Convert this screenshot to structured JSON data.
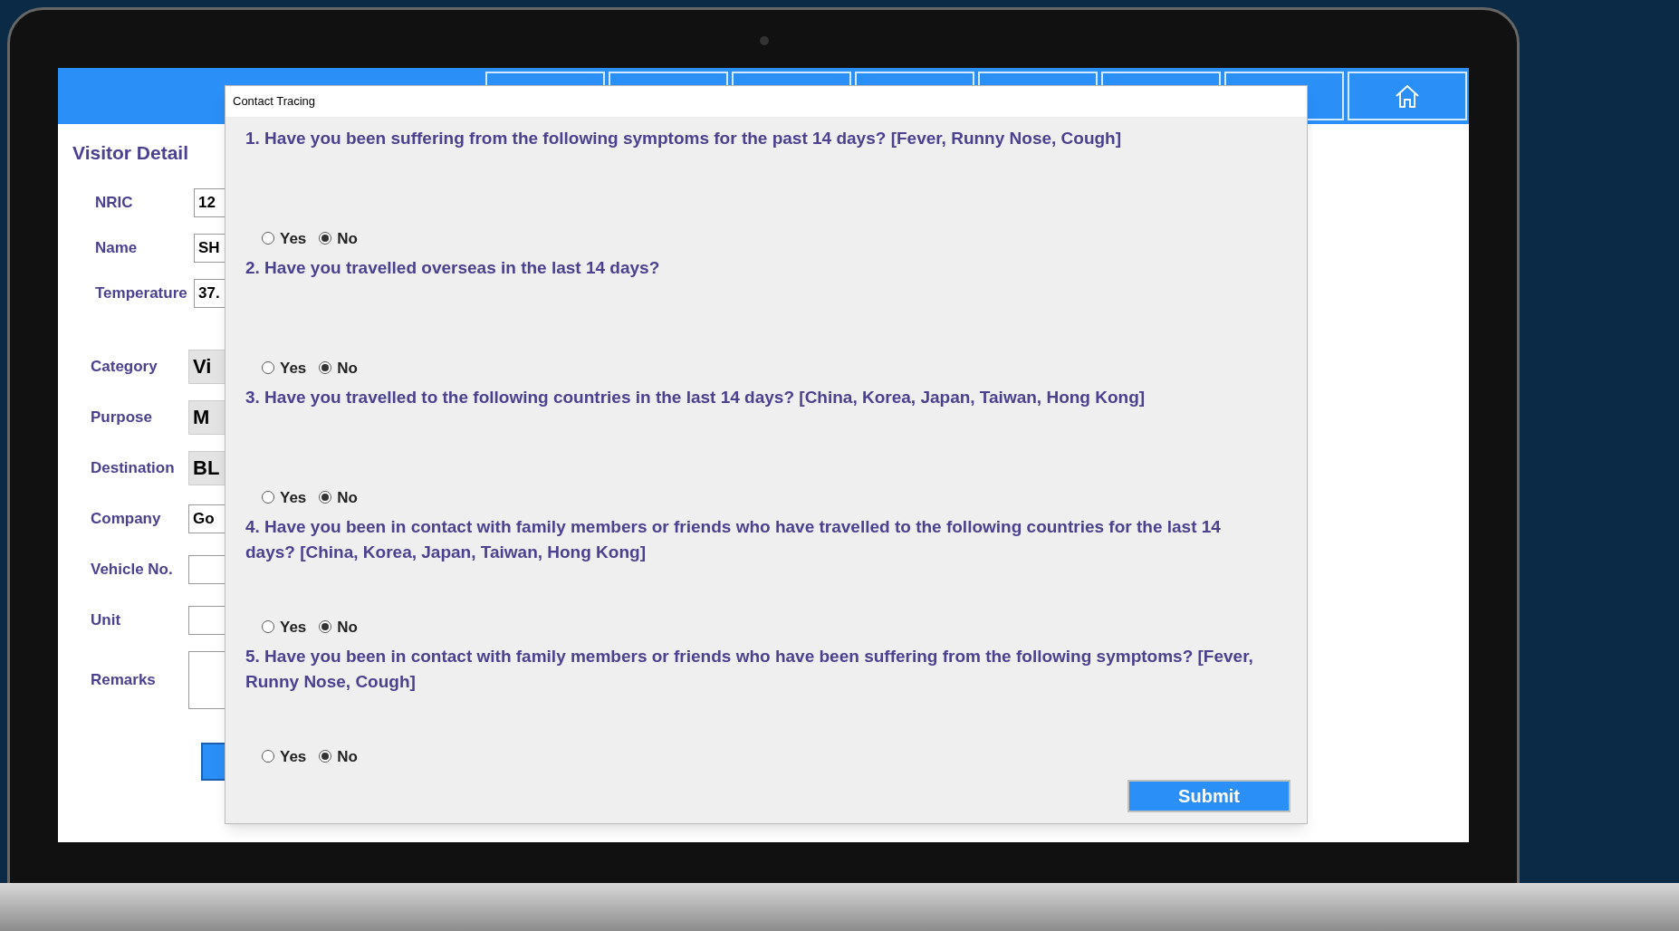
{
  "visitor_panel": {
    "title": "Visitor Detail",
    "fields": [
      {
        "label": "NRIC",
        "kind": "text",
        "value": "12"
      },
      {
        "label": "Name",
        "kind": "text",
        "value": "SH"
      },
      {
        "label": "Temperature",
        "kind": "text",
        "value": "37."
      },
      {
        "label": "Category",
        "kind": "dropdown",
        "value": "Vi"
      },
      {
        "label": "Purpose",
        "kind": "dropdown",
        "value": "M"
      },
      {
        "label": "Destination",
        "kind": "dropdown",
        "value": "BL"
      },
      {
        "label": "Company",
        "kind": "text",
        "value": "Go"
      },
      {
        "label": "Vehicle No.",
        "kind": "text"
      },
      {
        "label": "Unit",
        "kind": "text"
      },
      {
        "label": "Remarks",
        "kind": "multiline"
      }
    ]
  },
  "dialog": {
    "title": "Contact Tracing",
    "questions": [
      {
        "text": "1. Have you been suffering from the following symptoms for the past 14 days? [Fever, Runny Nose, Cough]",
        "options": [
          {
            "label": "Yes",
            "selected": false
          },
          {
            "label": "No",
            "selected": true
          }
        ]
      },
      {
        "text": "2. Have you travelled overseas in the last 14 days?",
        "options": [
          {
            "label": "Yes",
            "selected": false
          },
          {
            "label": "No",
            "selected": true
          }
        ]
      },
      {
        "text": "3. Have you travelled to the following countries in the last 14 days? [China, Korea, Japan, Taiwan, Hong Kong]",
        "options": [
          {
            "label": "Yes",
            "selected": false
          },
          {
            "label": "No",
            "selected": true
          }
        ]
      },
      {
        "text": "4. Have you been in contact with family members or friends who have travelled to the following countries for the last 14 days? [China, Korea, Japan, Taiwan, Hong Kong]",
        "options": [
          {
            "label": "Yes",
            "selected": false
          },
          {
            "label": "No",
            "selected": true
          }
        ]
      },
      {
        "text": "5. Have you been in contact with family members or friends who have been suffering from the following symptoms? [Fever, Runny Nose, Cough]",
        "options": [
          {
            "label": "Yes",
            "selected": false
          },
          {
            "label": "No",
            "selected": true
          }
        ]
      }
    ],
    "submit": "Submit"
  }
}
